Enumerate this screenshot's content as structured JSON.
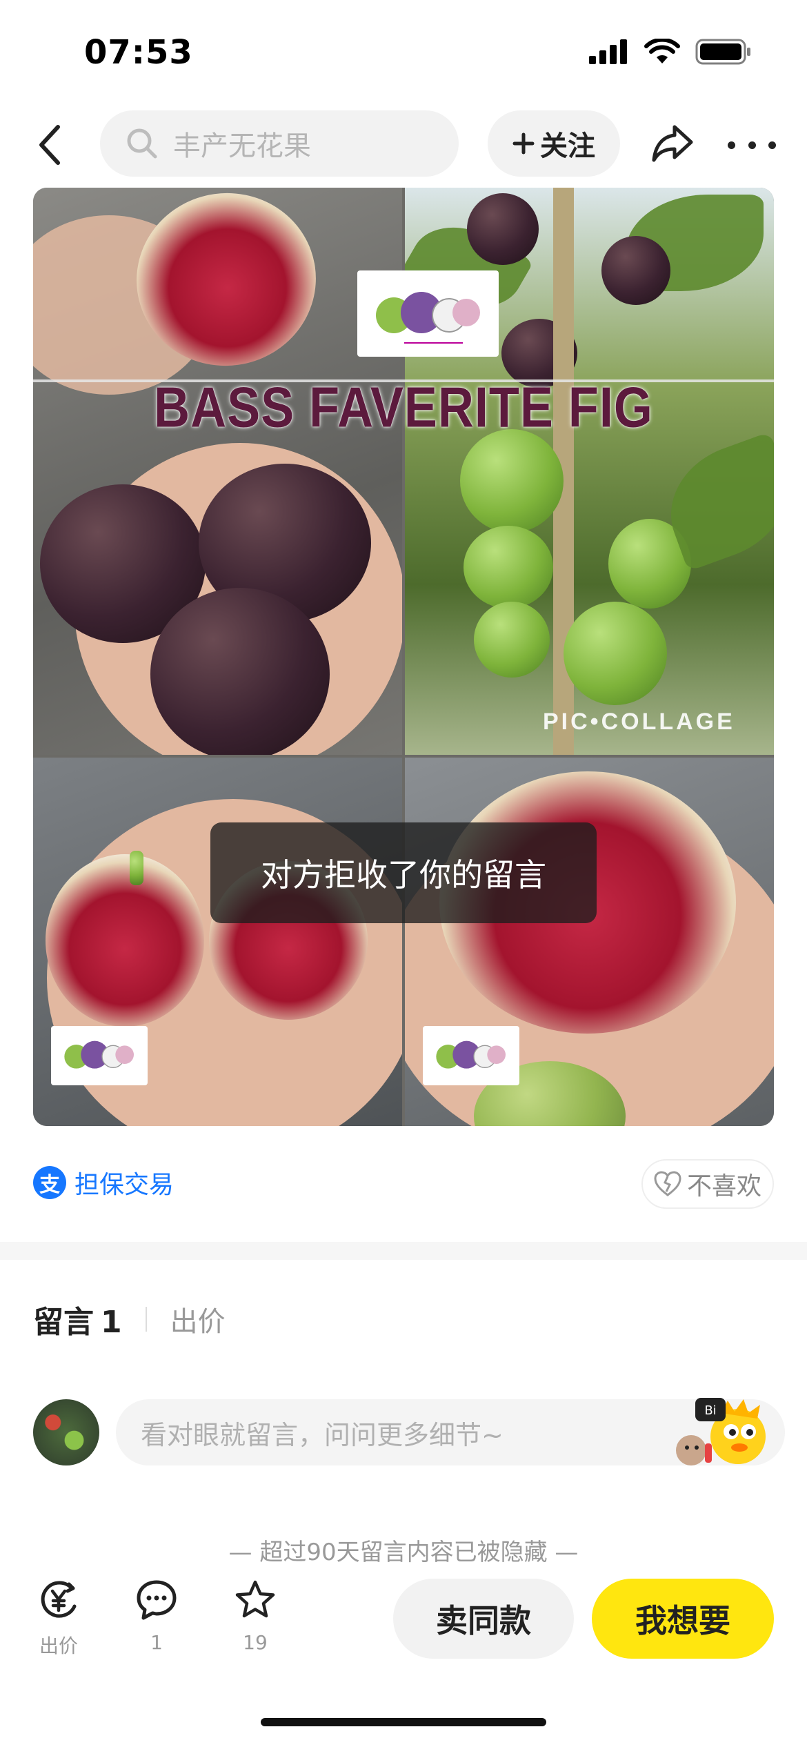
{
  "status_bar": {
    "time": "07:53"
  },
  "nav": {
    "search_placeholder": "丰产无花果",
    "follow_label": "关注"
  },
  "collage": {
    "title": "BASS FAVERITE FIG",
    "watermark": "PIC•COLLAGE"
  },
  "toast": {
    "message": "对方拒收了你的留言"
  },
  "guarantee": {
    "icon_text": "支",
    "label": "担保交易"
  },
  "dislike_label": "不喜欢",
  "tabs": {
    "comments_label": "留言",
    "comments_count": "1",
    "bids_label": "出价"
  },
  "comment_input": {
    "placeholder": "看对眼就留言，问问更多细节~"
  },
  "hidden_note": "— 超过90天留言内容已被隐藏 —",
  "bottom_bar": {
    "bid_label": "出价",
    "comment_count": "1",
    "favorite_count": "19",
    "same_button": "卖同款",
    "want_button": "我想要"
  },
  "colors": {
    "accent_yellow": "#ffe60f",
    "link_blue": "#1677ff"
  }
}
